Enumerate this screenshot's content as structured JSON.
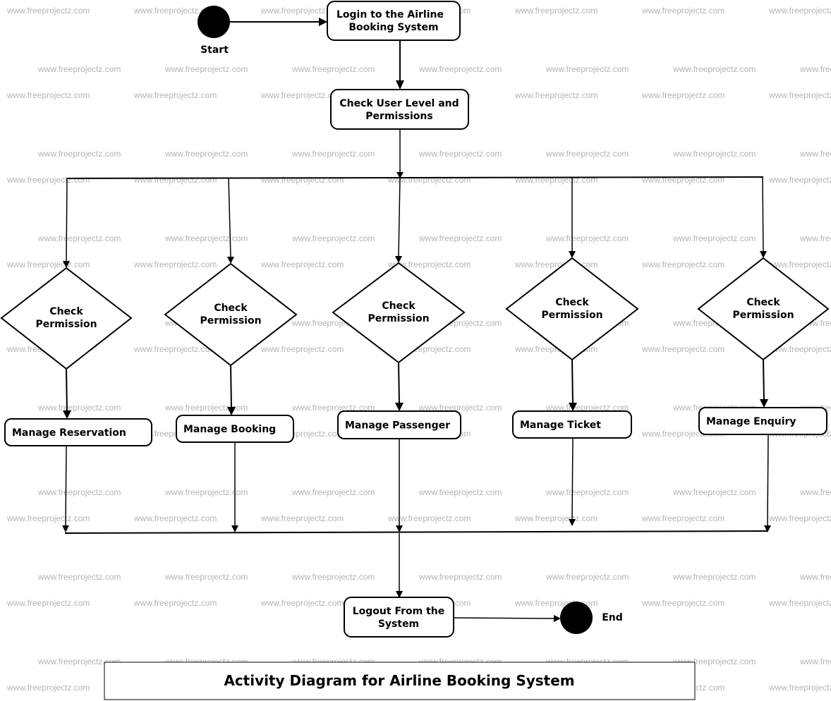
{
  "diagram": {
    "title": "Activity Diagram for Airline Booking System",
    "watermark": "www.freeprojectz.com",
    "start": {
      "label": "Start"
    },
    "end": {
      "label": "End"
    },
    "activities": {
      "login": [
        "Login to the Airline",
        "Booking System"
      ],
      "check_user_level": [
        "Check User Level and",
        "Permissions"
      ],
      "logout": [
        "Logout From the",
        "System"
      ]
    },
    "decisions": [
      {
        "id": "d1",
        "label": [
          "Check",
          "Permission"
        ]
      },
      {
        "id": "d2",
        "label": [
          "Check",
          "Permission"
        ]
      },
      {
        "id": "d3",
        "label": [
          "Check",
          "Permission"
        ]
      },
      {
        "id": "d4",
        "label": [
          "Check",
          "Permission"
        ]
      },
      {
        "id": "d5",
        "label": [
          "Check",
          "Permission"
        ]
      }
    ],
    "modules": [
      {
        "id": "m1",
        "label": "Manage Reservation"
      },
      {
        "id": "m2",
        "label": "Manage Booking"
      },
      {
        "id": "m3",
        "label": "Manage Passenger"
      },
      {
        "id": "m4",
        "label": "Manage Ticket"
      },
      {
        "id": "m5",
        "label": "Manage Enquiry"
      }
    ],
    "flow": [
      [
        "start",
        "login"
      ],
      [
        "login",
        "check_user_level"
      ],
      [
        "check_user_level",
        "fork"
      ],
      [
        "fork",
        "d1"
      ],
      [
        "fork",
        "d2"
      ],
      [
        "fork",
        "d3"
      ],
      [
        "fork",
        "d4"
      ],
      [
        "fork",
        "d5"
      ],
      [
        "d1",
        "m1"
      ],
      [
        "d2",
        "m2"
      ],
      [
        "d3",
        "m3"
      ],
      [
        "d4",
        "m4"
      ],
      [
        "d5",
        "m5"
      ],
      [
        "m1",
        "join"
      ],
      [
        "m2",
        "join"
      ],
      [
        "m3",
        "join"
      ],
      [
        "m4",
        "join"
      ],
      [
        "m5",
        "join"
      ],
      [
        "join",
        "logout"
      ],
      [
        "logout",
        "end"
      ]
    ]
  }
}
